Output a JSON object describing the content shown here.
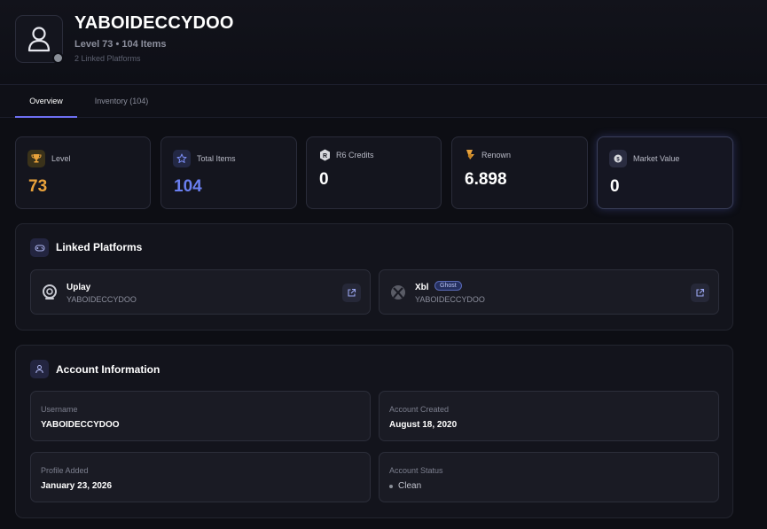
{
  "profile": {
    "username": "YABOIDECCYDOO",
    "subline": "Level 73 • 104 Items",
    "linked_count": "2 Linked Platforms"
  },
  "tabs": [
    {
      "label": "Overview",
      "active": true
    },
    {
      "label": "Inventory (104)",
      "active": false
    }
  ],
  "stats": [
    {
      "label": "Level",
      "value": "73",
      "icon": "trophy-icon",
      "value_color": "#e9a23b"
    },
    {
      "label": "Total Items",
      "value": "104",
      "icon": "star-icon",
      "value_color": "#6a7ff0"
    },
    {
      "label": "R6 Credits",
      "value": "0",
      "icon": "r6-credits-icon",
      "value_color": "#ffffff"
    },
    {
      "label": "Renown",
      "value": "6.898",
      "icon": "renown-icon",
      "value_color": "#ffffff"
    },
    {
      "label": "Market Value",
      "value": "0",
      "icon": "coin-icon",
      "value_color": "#ffffff"
    }
  ],
  "linked_platforms": {
    "title": "Linked Platforms",
    "items": [
      {
        "name": "Uplay",
        "username": "YABOIDECCYDOO",
        "badge": "",
        "icon": "uplay-icon"
      },
      {
        "name": "Xbl",
        "username": "YABOIDECCYDOO",
        "badge": "Ghost",
        "icon": "xbox-icon"
      }
    ]
  },
  "account_info": {
    "title": "Account Information",
    "username_label": "Username",
    "username_value": "YABOIDECCYDOO",
    "created_label": "Account Created",
    "created_value": "August 18, 2020",
    "added_label": "Profile Added",
    "added_value": "January 23, 2026",
    "status_label": "Account Status",
    "status_value": "Clean"
  },
  "colors": {
    "accent": "#6d6ff2",
    "background": "#0d0e14",
    "card": "#14151e"
  }
}
